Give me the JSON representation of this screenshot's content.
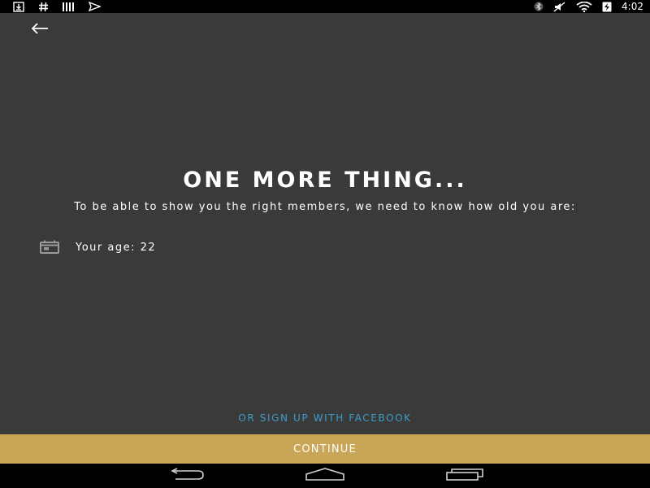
{
  "status_bar": {
    "time": "4:02",
    "left_icons": [
      "download-icon",
      "hashtag-icon",
      "bars-icon",
      "sent-icon"
    ],
    "right_icons": [
      "bluetooth-icon",
      "mute-icon",
      "wifi-icon",
      "battery-charging-icon"
    ]
  },
  "header": {
    "back_icon": "arrow-left-icon"
  },
  "main": {
    "title": "ONE MORE THING...",
    "subtitle": "To be able to show you the right members, we need to know how old you are:",
    "age_label": "Your age: 22",
    "age_icon": "calendar-icon"
  },
  "footer": {
    "facebook_link": "OR SIGN UP WITH FACEBOOK",
    "continue_label": "CONTINUE"
  },
  "nav_bar": {
    "icons": [
      "back-nav-icon",
      "home-nav-icon",
      "recents-nav-icon"
    ]
  },
  "colors": {
    "background": "#3a3a3a",
    "accent_gold": "#c9a657",
    "link_blue": "#3b9ec8"
  }
}
